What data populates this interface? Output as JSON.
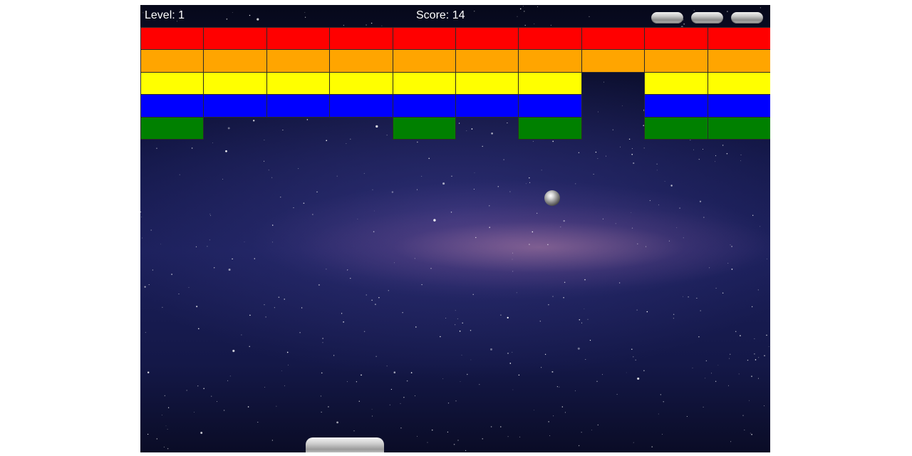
{
  "hud": {
    "level_text": "Level: 1",
    "score_text": "Score: 14",
    "lives_remaining": 3
  },
  "bricks": {
    "rows": 5,
    "columns": 10,
    "row_colors": [
      "#ff0000",
      "#ffa500",
      "#ffff00",
      "#0000ff",
      "#008000"
    ],
    "grid": [
      [
        1,
        1,
        1,
        1,
        1,
        1,
        1,
        1,
        1,
        1
      ],
      [
        1,
        1,
        1,
        1,
        1,
        1,
        1,
        1,
        1,
        1
      ],
      [
        1,
        1,
        1,
        1,
        1,
        1,
        1,
        0,
        1,
        1
      ],
      [
        1,
        1,
        1,
        1,
        1,
        1,
        1,
        0,
        1,
        1
      ],
      [
        1,
        0,
        0,
        0,
        1,
        0,
        1,
        0,
        1,
        1
      ]
    ]
  },
  "colors": {
    "hud_text": "#ffffff",
    "brick_border": "#2a2a2a"
  }
}
